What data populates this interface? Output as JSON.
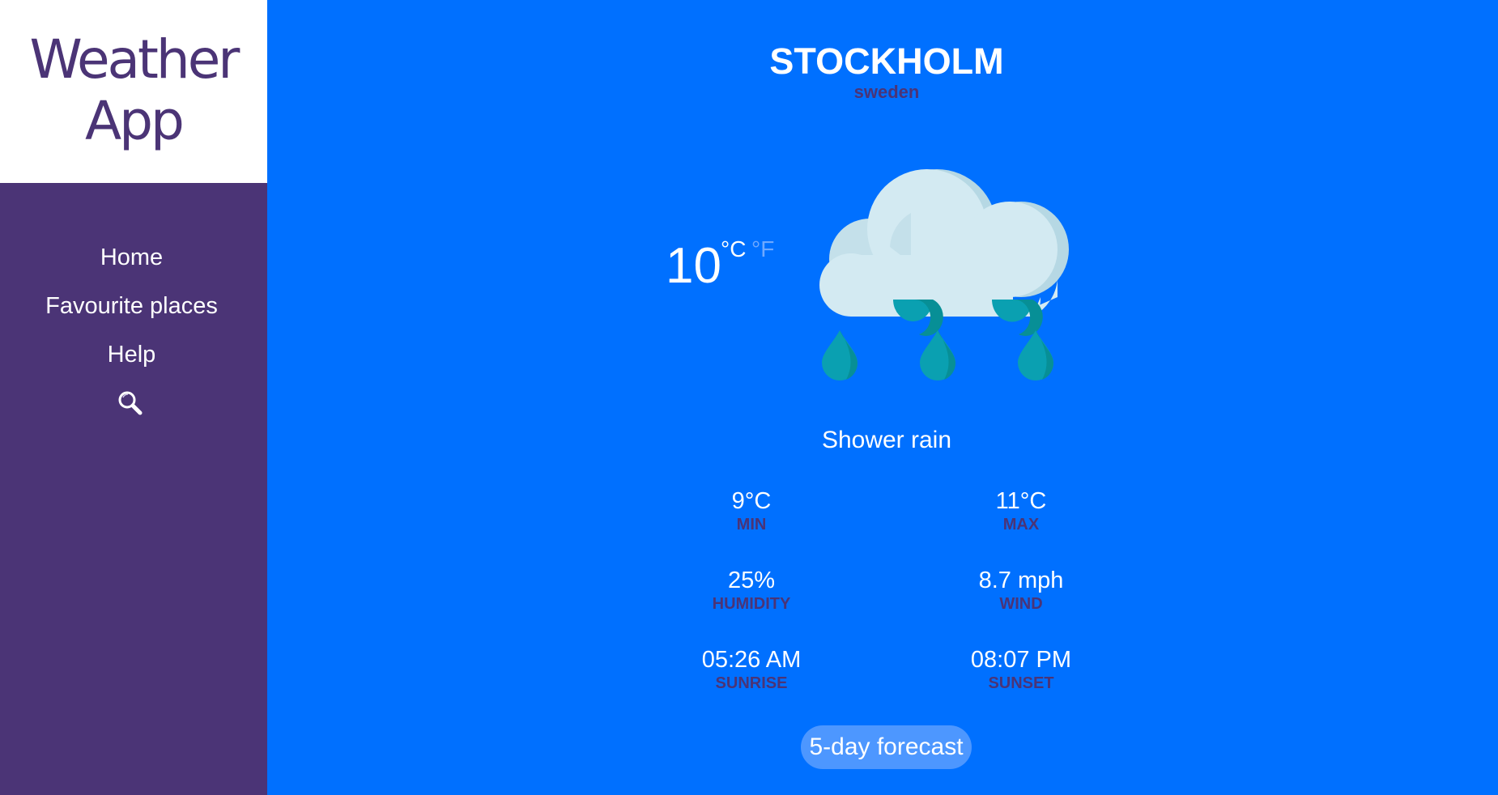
{
  "app": {
    "title_line1": "Weather",
    "title_line2": "App"
  },
  "nav": {
    "items": [
      {
        "label": "Home"
      },
      {
        "label": "Favourite places"
      },
      {
        "label": "Help"
      }
    ],
    "search_icon": "search-icon"
  },
  "location": {
    "city": "STOCKHOLM",
    "country": "sweden"
  },
  "current": {
    "temperature": "10",
    "unit_c": "°C",
    "unit_f": "°F",
    "description": "Shower rain",
    "icon": "rain-cloud-icon"
  },
  "stats": {
    "min": {
      "value": "9°C",
      "label": "MIN"
    },
    "max": {
      "value": "11°C",
      "label": "MAX"
    },
    "humidity": {
      "value": "25%",
      "label": "HUMIDITY"
    },
    "wind": {
      "value": "8.7 mph",
      "label": "WIND"
    },
    "sunrise": {
      "value": "05:26 AM",
      "label": "SUNRISE"
    },
    "sunset": {
      "value": "08:07 PM",
      "label": "SUNSET"
    }
  },
  "forecast_button": {
    "label": "5-day forecast"
  },
  "colors": {
    "sidebar": "#4B3476",
    "background": "#0070FF",
    "button": "#4D97FF",
    "inactive_unit": "#6FA9FF"
  }
}
